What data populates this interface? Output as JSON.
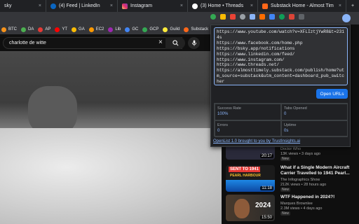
{
  "tabs": [
    {
      "label": "sky",
      "color": "#1185fe"
    },
    {
      "label": "(4) Feed | LinkedIn",
      "color": "#0a66c2"
    },
    {
      "label": "Instagram",
      "color": "#e1306c"
    },
    {
      "label": "(3) Home • Threads",
      "color": "#ffffff"
    },
    {
      "label": "Substack Home - Almost Tim",
      "color": "#ff6719"
    }
  ],
  "tab_close": "×",
  "new_tab": "+",
  "bookmarks": [
    {
      "label": "BTC",
      "color": "#f7931a"
    },
    {
      "label": "DA",
      "color": "#4caf50"
    },
    {
      "label": "AP",
      "color": "#e53935"
    },
    {
      "label": "YT",
      "color": "#ff0000"
    },
    {
      "label": "GA",
      "color": "#fbbc04"
    },
    {
      "label": "EC2",
      "color": "#ff9900"
    },
    {
      "label": "Lib",
      "color": "#9c27b0"
    },
    {
      "label": "GC",
      "color": "#4285f4"
    },
    {
      "label": "GCP",
      "color": "#34a853"
    },
    {
      "label": "Guild",
      "color": "#ffeb3b"
    },
    {
      "label": "Substack",
      "color": "#ff6719"
    }
  ],
  "search": {
    "query": "charlotte de witte",
    "clear": "×"
  },
  "popup": {
    "urls": "https://www.youtube.com/watch?v=XFLIztjYwR8&t=2314s\nhttps://www.facebook.com/home.php\nhttps://bsky.app/notifications\nhttps://www.linkedin.com/feed/\nhttps://www.instagram.com/\nhttps://www.threads.net/\nhttps://almosttimely.substack.com/publish/home?utm_source=substack&utm_content=dashboard_pub_switcher",
    "open_button": "Open URLs",
    "stats": [
      {
        "label": "Success Rate",
        "value": "100%"
      },
      {
        "label": "Tabs Opened",
        "value": "0"
      },
      {
        "label": "Errors",
        "value": "0"
      },
      {
        "label": "Uptime",
        "value": "0s"
      }
    ],
    "credit": "OpenList 1.0 brought to you by TrustInsights.ai"
  },
  "recommendations": [
    {
      "title": "",
      "channel": "Doctor Who",
      "meta": "13K views • 3 days ago",
      "badge": "New",
      "duration": "20:17",
      "thumb": "#2a2a3a"
    },
    {
      "title": "What if a Single Modern Aircraft Carrier Travelled to 1941 Pearl...",
      "channel": "The Infographics Show",
      "meta": "212K views • 28 hours ago",
      "badge": "New",
      "duration": "11:18",
      "thumb": "#6a1b1b",
      "thumb_text": "SENT TO 1941",
      "thumb_sub": "PEARL HARBOUR"
    },
    {
      "title": "WTF Happened in 2024?!",
      "channel": "Marques Brownlee",
      "meta": "2.3M views • 4 days ago",
      "badge": "New",
      "duration": "15:50",
      "thumb": "#3b2b1f",
      "thumb_text": "2024"
    }
  ]
}
